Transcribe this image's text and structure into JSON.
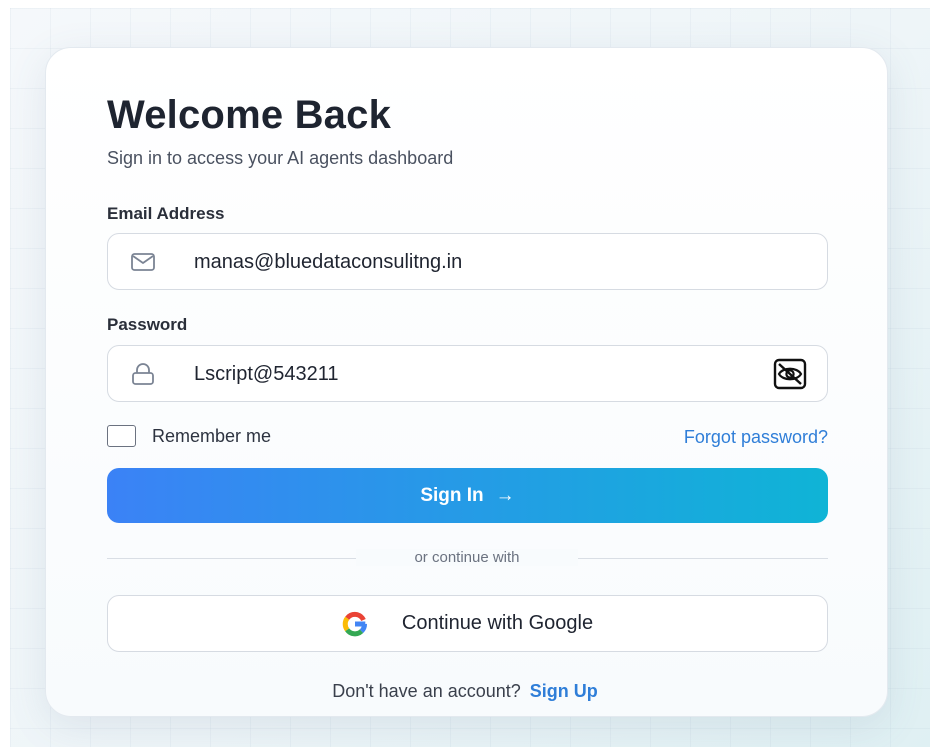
{
  "login": {
    "title": "Welcome Back",
    "subtitle": "Sign in to access your AI agents dashboard",
    "email": {
      "label": "Email Address",
      "value": "manas@bluedataconsulitng.in",
      "icon": "mail-icon"
    },
    "password": {
      "label": "Password",
      "value": "Lscript@543211",
      "icon": "lock-icon",
      "toggle_icon": "eye-off-icon"
    },
    "remember_label": "Remember me",
    "remember_checked": false,
    "forgot_label": "Forgot password?",
    "signin_label": "Sign In",
    "signin_arrow": "→",
    "divider_text": "or continue with",
    "google_label": "Continue with Google",
    "footer_text": "Don't have an account?",
    "signup_label": "Sign Up"
  },
  "colors": {
    "accent": "#2f7ed8",
    "button_gradient_start": "#3b82f6",
    "button_gradient_end": "#0fb4d6",
    "title": "#1e2430"
  }
}
